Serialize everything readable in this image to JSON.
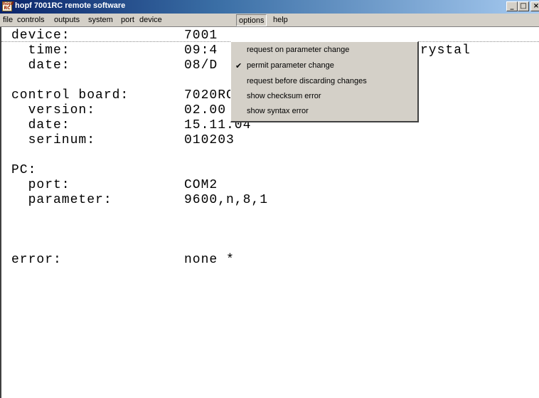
{
  "window": {
    "title": "hopf 7001RC remote software",
    "icon_text": "hopf RC",
    "minimize": "_",
    "maximize": "□",
    "close": "×"
  },
  "menubar": {
    "items": [
      "file",
      "controls",
      "outputs",
      "system",
      "port",
      "device",
      "options",
      "help"
    ],
    "open_item": "options"
  },
  "dropdown": {
    "items": [
      {
        "label": "request on parameter change",
        "checked": false
      },
      {
        "label": "permit parameter change",
        "checked": true
      },
      {
        "label": "request before discarding changes",
        "checked": false
      },
      {
        "label": "show checksum error",
        "checked": false
      },
      {
        "label": "show syntax error",
        "checked": false
      }
    ],
    "check_mark": "✔"
  },
  "content": {
    "device_label": "device:",
    "device_value": "7001",
    "time_label": "  time:",
    "time_value": "09:4",
    "time_suffix": "rystal",
    "date_label": "  date:",
    "date_value": "08/D",
    "control_board_label": "control board:",
    "control_board_value": "7020RC",
    "version_label": "  version:",
    "version_value": "02.00",
    "cb_date_label": "  date:",
    "cb_date_value": "15.11.04",
    "serinum_label": "  serinum:",
    "serinum_value": "010203",
    "pc_label": "PC:",
    "port_label": "  port:",
    "port_value": "COM2",
    "parameter_label": "  parameter:",
    "parameter_value": "9600,n,8,1",
    "error_label": "error:",
    "error_value": "none *"
  }
}
